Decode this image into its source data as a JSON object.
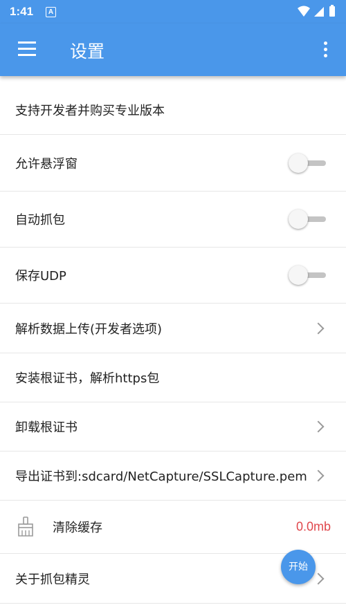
{
  "statusbar": {
    "time": "1:41",
    "notification_glyph": "A"
  },
  "appbar": {
    "title": "设置"
  },
  "settings": {
    "support_pro": "支持开发者并购买专业版本",
    "floating_window": {
      "label": "允许悬浮窗",
      "enabled": false
    },
    "auto_capture": {
      "label": "自动抓包",
      "enabled": false
    },
    "save_udp": {
      "label": "保存UDP",
      "enabled": false
    },
    "parse_upload": "解析数据上传(开发者选项)",
    "install_cert": "安装根证书，解析https包",
    "uninstall_cert": "卸载根证书",
    "export_cert": "导出证书到:sdcard/NetCapture/SSLCapture.pem",
    "clear_cache": {
      "label": "清除缓存",
      "value": "0.0mb"
    },
    "about": "关于抓包精灵"
  },
  "fab": {
    "label": "开始"
  },
  "colors": {
    "primary": "#4a97ea",
    "cache_value": "#e0474c"
  }
}
